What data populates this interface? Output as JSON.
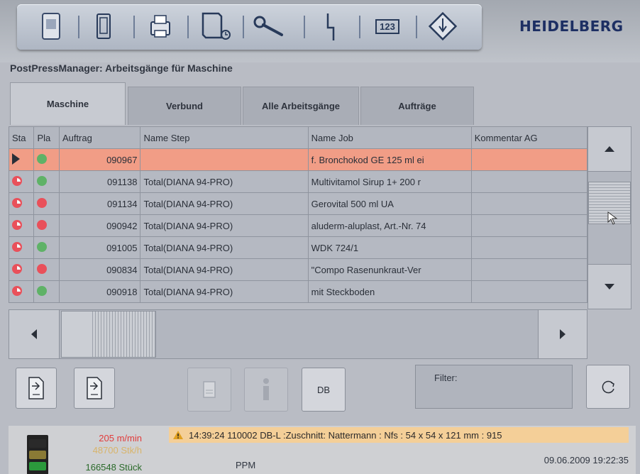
{
  "brand": "HEIDELBERG",
  "window_title": "PostPressManager: Arbeitsgänge für Maschine",
  "toolbar": {
    "icons": [
      "machine-panel-icon",
      "tablet-icon",
      "printer-icon",
      "document-clock-icon",
      "wrench-icon",
      "signal-icon",
      "counter-icon",
      "diamond-arrow-icon"
    ],
    "counter_label": "123"
  },
  "tabs": [
    {
      "label": "Maschine",
      "active": true
    },
    {
      "label": "Verbund",
      "active": false
    },
    {
      "label": "Alle Arbeitsgänge",
      "active": false
    },
    {
      "label": "Aufträge",
      "active": false
    }
  ],
  "table": {
    "columns": [
      "Sta",
      "Pla",
      "Auftrag",
      "Name Step",
      "Name Job",
      "Kommentar AG"
    ],
    "rows": [
      {
        "status": "play",
        "plan": "green",
        "auftrag": "090967",
        "step": "",
        "job": "f. Bronchokod GE 125 ml ei",
        "kommentar": "",
        "selected": true
      },
      {
        "status": "partial",
        "plan": "green",
        "auftrag": "091138",
        "step": "Total(DIANA 94-PRO)",
        "job": "Multivitamol Sirup 1+  200 r",
        "kommentar": "",
        "selected": false
      },
      {
        "status": "partial",
        "plan": "red",
        "auftrag": "091134",
        "step": "Total(DIANA 94-PRO)",
        "job": "Gerovital 500 ml UA",
        "kommentar": "",
        "selected": false
      },
      {
        "status": "partial",
        "plan": "red",
        "auftrag": "090942",
        "step": "Total(DIANA 94-PRO)",
        "job": "aluderm-aluplast, Art.-Nr. 74",
        "kommentar": "",
        "selected": false
      },
      {
        "status": "partial",
        "plan": "green",
        "auftrag": "091005",
        "step": "Total(DIANA 94-PRO)",
        "job": "WDK 724/1",
        "kommentar": "",
        "selected": false
      },
      {
        "status": "partial",
        "plan": "red",
        "auftrag": "090834",
        "step": "Total(DIANA 94-PRO)",
        "job": "\"Compo Rasenunkraut-Ver",
        "kommentar": "",
        "selected": false
      },
      {
        "status": "partial",
        "plan": "green",
        "auftrag": "090918",
        "step": "Total(DIANA 94-PRO)",
        "job": "mit Steckboden",
        "kommentar": "",
        "selected": false
      }
    ]
  },
  "bottom": {
    "db_label": "DB",
    "filter_label": "Filter:"
  },
  "statusbar": {
    "speed": "205 m/min",
    "rate": "48700 Stk/h",
    "count": "166548 Stück",
    "mode": "PPM",
    "message": "14:39:24 110002  DB-L :Zuschnitt: Nattermann : Nfs : 54 x 54 x 121 mm : 915",
    "datetime": "09.06.2009  19:22:35"
  },
  "colors": {
    "selected_row": "#f19d86",
    "plan_green": "#5fb267",
    "plan_red": "#e9505a",
    "message_bg": "#f4cf98",
    "speed_text": "#e23b3b",
    "count_text": "#2a6a2a"
  }
}
